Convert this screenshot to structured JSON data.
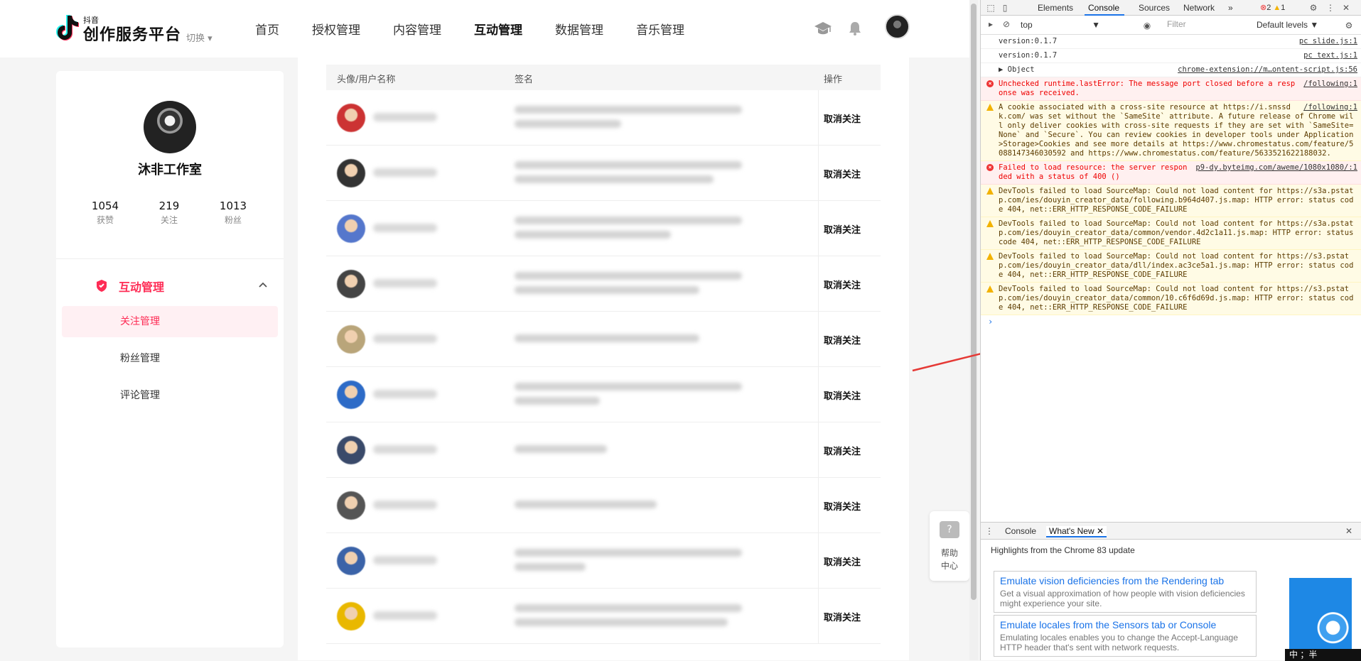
{
  "brand": {
    "small": "抖音",
    "main": "创作服务平台",
    "switch_label": "切换"
  },
  "nav": {
    "items": [
      "首页",
      "授权管理",
      "内容管理",
      "互动管理",
      "数据管理",
      "音乐管理"
    ],
    "active_index": 3
  },
  "profile": {
    "name": "沐非工作室",
    "stats": [
      {
        "num": "1054",
        "label": "获赞"
      },
      {
        "num": "219",
        "label": "关注"
      },
      {
        "num": "1013",
        "label": "粉丝"
      }
    ]
  },
  "menu": {
    "title": "互动管理",
    "items": [
      "关注管理",
      "粉丝管理",
      "评论管理"
    ],
    "active_index": 0
  },
  "table": {
    "headers": [
      "头像/用户名称",
      "签名",
      "操作"
    ],
    "action_label": "取消关注",
    "row_count": 10
  },
  "help": {
    "line1": "帮助",
    "line2": "中心",
    "icon": "?"
  },
  "devtools": {
    "tabs": [
      "Elements",
      "Console",
      "Sources",
      "Network"
    ],
    "more": "»",
    "errors": "2",
    "warnings": "1",
    "context": "top",
    "filter_placeholder": "Filter",
    "levels": "Default levels ▼",
    "messages": [
      {
        "type": "log",
        "text": "version:0.1.7",
        "src": "pc slide.js:1"
      },
      {
        "type": "log",
        "text": "version:0.1.7",
        "src": "pc text.js:1"
      },
      {
        "type": "log",
        "text": "▶ Object",
        "src": "chrome-extension://m…ontent-script.js:56"
      },
      {
        "type": "err",
        "text": "Unchecked runtime.lastError: The message port closed before a response was received.",
        "src": "/following:1"
      },
      {
        "type": "warn",
        "text": "A cookie associated with a cross-site resource at https://i.snssdk.com/ was set without the `SameSite` attribute. A future release of Chrome will only deliver cookies with cross-site requests if they are set with `SameSite=None` and `Secure`. You can review cookies in developer tools under Application>Storage>Cookies and see more details at https://www.chromestatus.com/feature/5088147346030592 and https://www.chromestatus.com/feature/5633521622188032.",
        "src": "/following:1"
      },
      {
        "type": "err",
        "text": "Failed to load resource: the server responded with a status of 400 ()",
        "src": "p9-dy.byteimg.com/aweme/1080x1080/:1"
      },
      {
        "type": "warn",
        "text": "DevTools failed to load SourceMap: Could not load content for https://s3a.pstatp.com/ies/douyin_creator_data/following.b964d407.js.map: HTTP error: status code 404, net::ERR_HTTP_RESPONSE_CODE_FAILURE",
        "src": ""
      },
      {
        "type": "warn",
        "text": "DevTools failed to load SourceMap: Could not load content for https://s3a.pstatp.com/ies/douyin_creator_data/common/vendor.4d2c1a11.js.map: HTTP error: status code 404, net::ERR_HTTP_RESPONSE_CODE_FAILURE",
        "src": ""
      },
      {
        "type": "warn",
        "text": "DevTools failed to load SourceMap: Could not load content for https://s3.pstatp.com/ies/douyin_creator_data/dll/index.ac3ce5a1.js.map: HTTP error: status code 404, net::ERR_HTTP_RESPONSE_CODE_FAILURE",
        "src": ""
      },
      {
        "type": "warn",
        "text": "DevTools failed to load SourceMap: Could not load content for https://s3.pstatp.com/ies/douyin_creator_data/common/10.c6f6d69d.js.map: HTTP error: status code 404, net::ERR_HTTP_RESPONSE_CODE_FAILURE",
        "src": ""
      }
    ],
    "prompt": "›",
    "drawer": {
      "tabs": [
        "Console",
        "What's New"
      ],
      "title": "Highlights from the Chrome 83 update",
      "cards": [
        {
          "title": "Emulate vision deficiencies from the Rendering tab",
          "desc": "Get a visual approximation of how people with vision deficiencies might experience your site."
        },
        {
          "title": "Emulate locales from the Sensors tab or Console",
          "desc": "Emulating locales enables you to change the Accept-Language HTTP header that's sent with network requests."
        }
      ]
    },
    "ime": "中 ；半"
  }
}
